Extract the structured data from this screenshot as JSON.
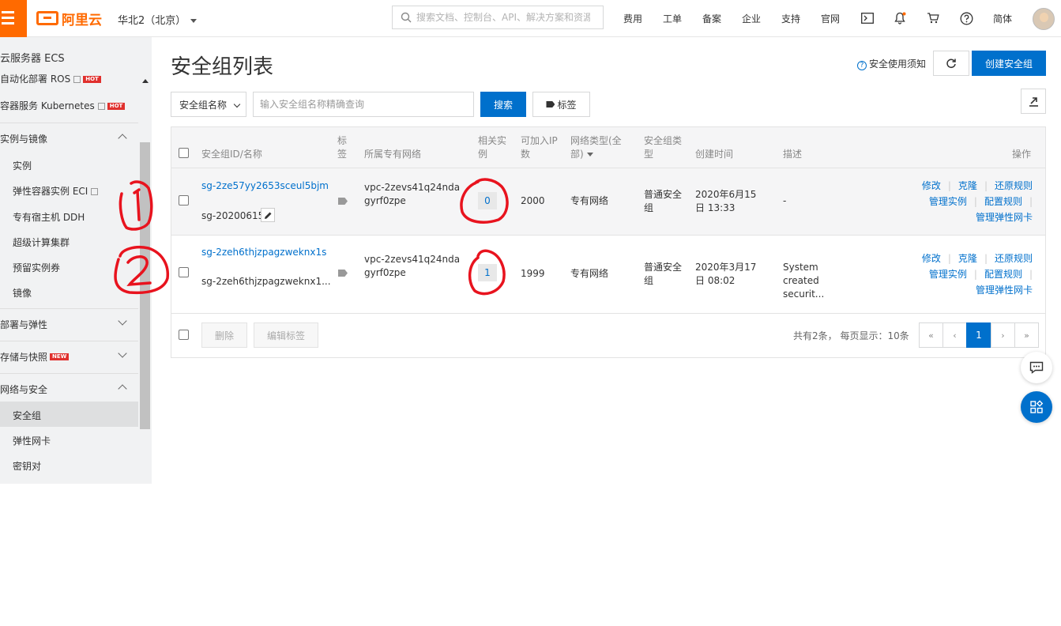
{
  "header": {
    "logo_text": "阿里云",
    "region": "华北2（北京）",
    "search_placeholder": "搜索文档、控制台、API、解决方案和资源",
    "nav": [
      "费用",
      "工单",
      "备案",
      "企业",
      "支持",
      "官网"
    ],
    "lang": "简体"
  },
  "sidebar": {
    "title": "云服务器 ECS",
    "items": {
      "ros": "自动化部署 ROS",
      "k8s": "容器服务 Kubernetes",
      "group_instances": "实例与镜像",
      "instance": "实例",
      "eci": "弹性容器实例 ECI",
      "ddh": "专有宿主机 DDH",
      "super": "超级计算集群",
      "reserved": "预留实例券",
      "image": "镜像",
      "group_deploy": "部署与弹性",
      "group_storage": "存储与快照",
      "group_network": "网络与安全",
      "secgroup": "安全组",
      "eni": "弹性网卡",
      "keypair": "密钥对"
    },
    "badges": {
      "hot": "HOT",
      "new": "NEW"
    }
  },
  "main": {
    "title": "安全组列表",
    "help": "安全使用须知",
    "create_button": "创建安全组",
    "filter_select": "安全组名称",
    "query_placeholder": "输入安全组名称精确查询",
    "search_button": "搜索",
    "tag_button": "标签"
  },
  "table": {
    "headers": {
      "id": "安全组ID/名称",
      "tag": "标签",
      "vpc": "所属专有网络",
      "instances": "相关实例",
      "ip": "可加入IP数",
      "nettype": "网络类型(全部)",
      "sgtype": "安全组类型",
      "created": "创建时间",
      "desc": "描述",
      "ops": "操作"
    },
    "rows": [
      {
        "id": "sg-2ze57yy2653sceul5bjm",
        "name": "sg-20200615",
        "vpc": "vpc-2zevs41q24ndagyrf0zpe",
        "instances": "0",
        "ip": "2000",
        "nettype": "专有网络",
        "sgtype": "普通安全组",
        "created": "2020年6月15日 13:33",
        "desc": "-"
      },
      {
        "id": "sg-2zeh6thjzpagzweknx1s",
        "name": "sg-2zeh6thjzpagzweknx1...",
        "vpc": "vpc-2zevs41q24ndagyrf0zpe",
        "instances": "1",
        "ip": "1999",
        "nettype": "专有网络",
        "sgtype": "普通安全组",
        "created": "2020年3月17日 08:02",
        "desc": "System created securit..."
      }
    ],
    "ops": {
      "modify": "修改",
      "clone": "克隆",
      "restore": "还原规则",
      "manage_instances": "管理实例",
      "config_rules": "配置规则",
      "manage_eni": "管理弹性网卡"
    },
    "footer": {
      "delete": "删除",
      "edit_tags": "编辑标签",
      "summary": "共有2条， 每页显示：10条",
      "current_page": "1"
    }
  },
  "accent_color": "#0070cc",
  "brand_color": "#ff6a00"
}
